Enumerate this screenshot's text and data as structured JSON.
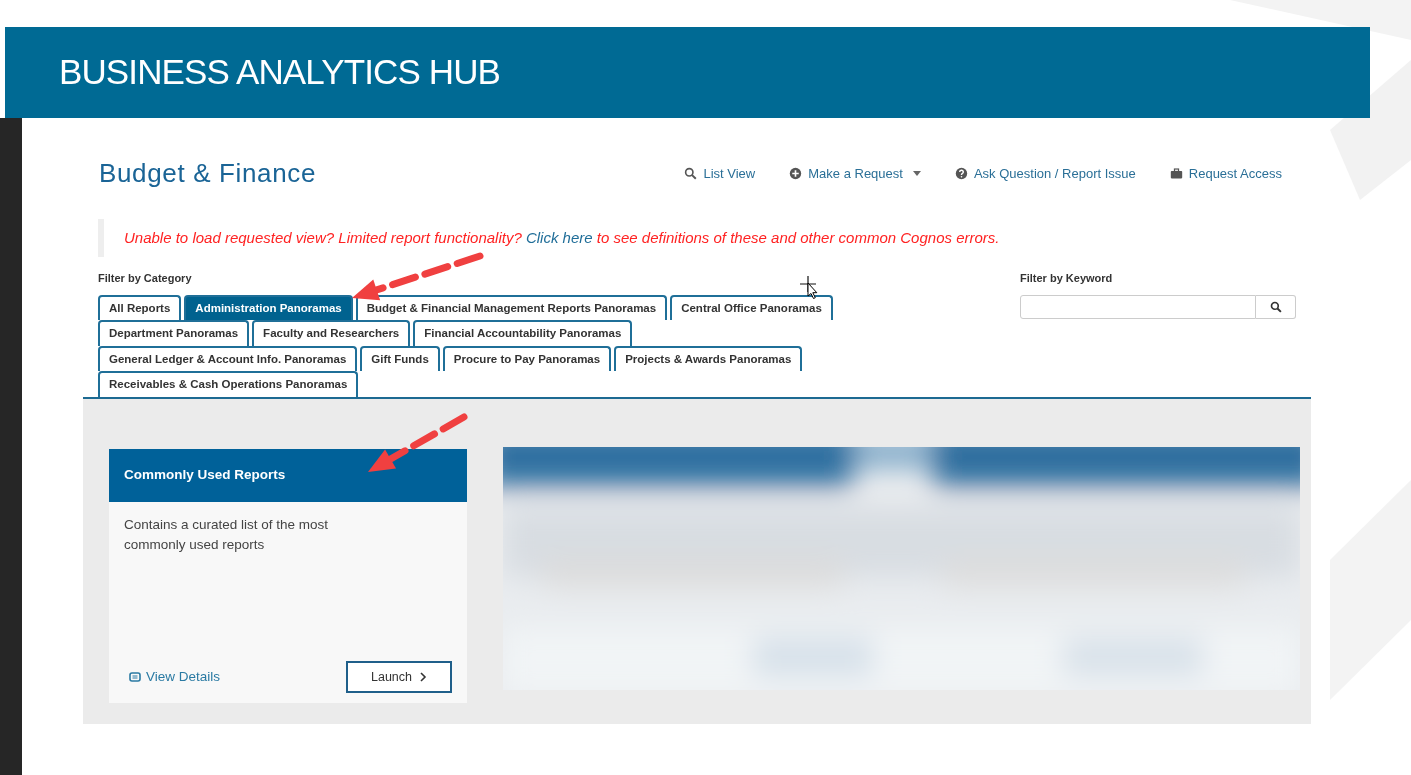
{
  "banner": {
    "title": "BUSINESS ANALYTICS HUB"
  },
  "page": {
    "title": "Budget & Finance",
    "nav": [
      {
        "kind": "search",
        "label": "List View",
        "caret": false
      },
      {
        "kind": "plus",
        "label": "Make a Request",
        "caret": true
      },
      {
        "kind": "question",
        "label": "Ask Question / Report Issue",
        "caret": false
      },
      {
        "kind": "briefcase",
        "label": "Request Access",
        "caret": false
      }
    ],
    "notice": {
      "before": "Unable to load requested view? Limited report functionality?",
      "link": "Click here",
      "after": "to see definitions of these and other common Cognos errors."
    },
    "category_filter": {
      "label": "Filter by Category",
      "tab_rows": [
        [
          {
            "label": "All Reports",
            "selected": false
          },
          {
            "label": "Administration Panoramas",
            "selected": true
          },
          {
            "label": "Budget & Financial Management Reports Panoramas",
            "selected": false
          },
          {
            "label": "Central Office Panoramas",
            "selected": false
          }
        ],
        [
          {
            "label": "Department Panoramas",
            "selected": false
          },
          {
            "label": "Faculty and Researchers",
            "selected": false
          },
          {
            "label": "Financial Accountability Panoramas",
            "selected": false
          }
        ],
        [
          {
            "label": "General Ledger & Account Info. Panoramas",
            "selected": false
          },
          {
            "label": "Gift Funds",
            "selected": false
          },
          {
            "label": "Procure to Pay Panoramas",
            "selected": false
          },
          {
            "label": "Projects & Awards Panoramas",
            "selected": false
          }
        ],
        [
          {
            "label": "Receivables & Cash Operations Panoramas",
            "selected": false
          }
        ]
      ]
    },
    "keyword_filter": {
      "label": "Filter by Keyword"
    },
    "card": {
      "title": "Commonly Used Reports",
      "description": "Contains a curated list of the most commonly used reports",
      "details_link": "View Details",
      "launch_button": "Launch"
    }
  }
}
